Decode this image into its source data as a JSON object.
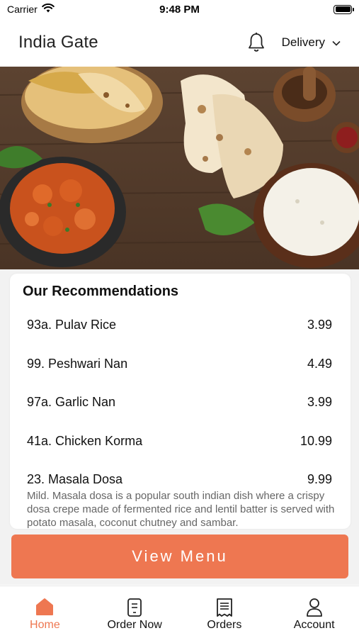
{
  "status_bar": {
    "carrier": "Carrier",
    "time": "9:48 PM"
  },
  "header": {
    "title": "India Gate",
    "delivery_label": "Delivery"
  },
  "recommendations": {
    "title": "Our Recommendations",
    "items": [
      {
        "name": "93a. Pulav Rice",
        "price": "3.99"
      },
      {
        "name": "99. Peshwari Nan",
        "price": "4.49"
      },
      {
        "name": "97a. Garlic Nan",
        "price": "3.99"
      },
      {
        "name": "41a. Chicken Korma",
        "price": "10.99"
      },
      {
        "name": "23. Masala Dosa",
        "price": "9.99",
        "description": "Mild. Masala dosa is a popular south indian dish where a crispy dosa crepe made of fermented rice and lentil batter is served with potato masala, coconut chutney and sambar."
      }
    ]
  },
  "view_menu_label": "View Menu",
  "tabs": [
    {
      "label": "Home",
      "icon": "home-icon",
      "active": true
    },
    {
      "label": "Order Now",
      "icon": "menu-card-icon",
      "active": false
    },
    {
      "label": "Orders",
      "icon": "receipt-icon",
      "active": false
    },
    {
      "label": "Account",
      "icon": "user-icon",
      "active": false
    }
  ],
  "colors": {
    "accent": "#ee7751",
    "background": "#f2f2f2"
  }
}
